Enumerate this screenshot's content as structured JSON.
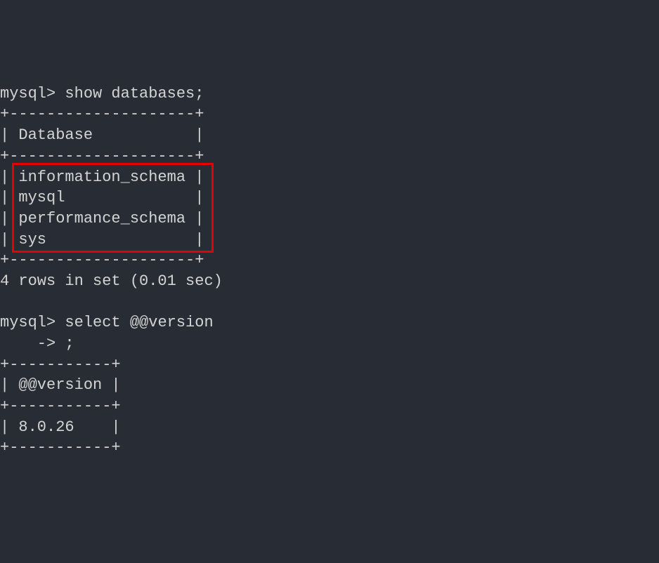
{
  "terminal": {
    "prompt": "mysql>",
    "continuation_prompt": "    ->",
    "command1": "show databases;",
    "table1_border": "+--------------------+",
    "table1_header_line": "| Database           |",
    "table1_rows": [
      "| information_schema |",
      "| mysql              |",
      "| performance_schema |",
      "| sys                |"
    ],
    "result1_summary": "4 rows in set (0.01 sec)",
    "command2": "select @@version",
    "command2_cont": ";",
    "table2_border": "+-----------+",
    "table2_header_line": "| @@version |",
    "table2_row": "| 8.0.26    |"
  }
}
